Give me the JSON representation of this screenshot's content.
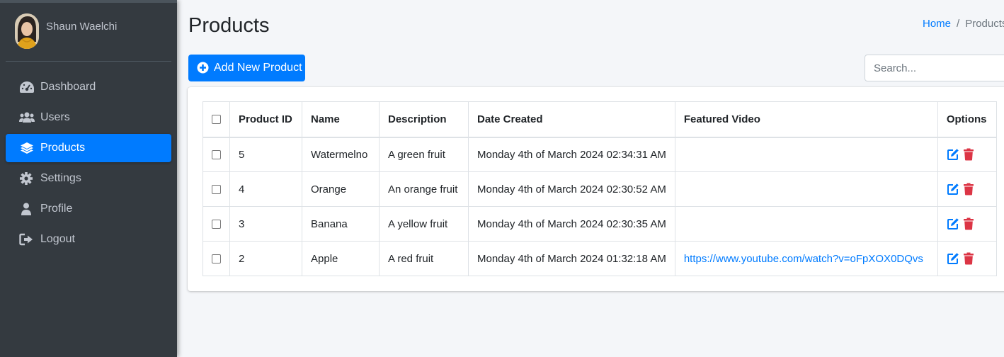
{
  "user": {
    "name": "Shaun Waelchi"
  },
  "nav": [
    {
      "label": "Dashboard",
      "icon": "dashboard-icon"
    },
    {
      "label": "Users",
      "icon": "users-icon"
    },
    {
      "label": "Products",
      "icon": "layers-icon",
      "active": true
    },
    {
      "label": "Settings",
      "icon": "gear-icon"
    },
    {
      "label": "Profile",
      "icon": "user-icon"
    },
    {
      "label": "Logout",
      "icon": "logout-icon"
    }
  ],
  "page": {
    "title": "Products"
  },
  "breadcrumb": {
    "home": "Home",
    "separator": "/",
    "current": "Products"
  },
  "toolbar": {
    "add_label": "Add New Product",
    "search_placeholder": "Search..."
  },
  "table": {
    "headers": [
      "Product ID",
      "Name",
      "Description",
      "Date Created",
      "Featured Video",
      "Options"
    ],
    "rows": [
      {
        "id": "5",
        "name": "Watermelno",
        "description": "A green fruit",
        "date": "Monday 4th of March 2024 02:34:31 AM",
        "video": ""
      },
      {
        "id": "4",
        "name": "Orange",
        "description": "An orange fruit",
        "date": "Monday 4th of March 2024 02:30:52 AM",
        "video": ""
      },
      {
        "id": "3",
        "name": "Banana",
        "description": "A yellow fruit",
        "date": "Monday 4th of March 2024 02:30:35 AM",
        "video": ""
      },
      {
        "id": "2",
        "name": "Apple",
        "description": "A red fruit",
        "date": "Monday 4th of March 2024 01:32:18 AM",
        "video": "https://www.youtube.com/watch?v=oFpXOX0DQvs"
      }
    ]
  },
  "colors": {
    "sidebar_bg": "#343a40",
    "primary": "#007bff",
    "danger": "#dc3545",
    "page_bg": "#f4f6f9"
  }
}
